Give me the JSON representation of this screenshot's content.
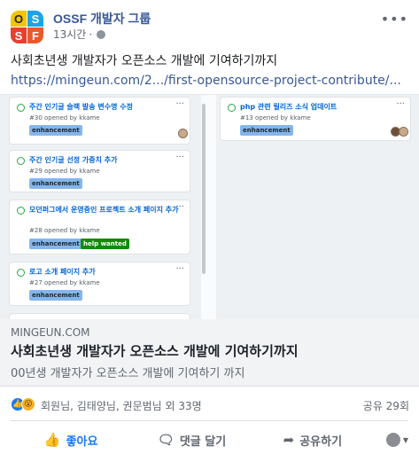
{
  "post": {
    "page_name": "OSSF 개발자 그룹",
    "time": "13시간",
    "meta_separator": "·",
    "text": "사회초년생 개발자가 오픈소스 개발에 기여하기까지",
    "link": "https://mingeun.com/2.../first-opensource-project-contribute/..."
  },
  "logo_letters": [
    "O",
    "S",
    "S",
    "F"
  ],
  "board": {
    "left_column": [
      {
        "title": "주간 인기글 슬랙 발송 변수명 수정",
        "sub": "#30 opened by kkame",
        "labels": [
          "enhancement"
        ]
      },
      {
        "title": "주간 인기글 선정 가중치 추가",
        "sub": "#29 opened by kkame",
        "labels": [
          "enhancement"
        ]
      },
      {
        "title": "모던퍼그에서 운영중인 프로젝트 소개 페이지 추가",
        "sub": "#28 opened by kkame",
        "labels": [
          "enhancement",
          "help wanted"
        ]
      },
      {
        "title": "로고 소개 페이지 추가",
        "sub": "#27 opened by kkame",
        "labels": [
          "enhancement"
        ]
      }
    ],
    "right_column": [
      {
        "title": "php 관련 릴리즈 소식 업데이트",
        "sub": "#13 opened by kkame",
        "labels": [
          "enhancement"
        ]
      }
    ]
  },
  "link_preview": {
    "domain": "MINGEUN.COM",
    "title": "사회초년생 개발자가 오픈소스 개발에 기여하기까지",
    "description": "00년생 개발자가 오픈소스 개발에 기여하기 까지"
  },
  "reactions": {
    "names": "회원님, 김태양님, 권문범님 외 33명",
    "shares": "공유 29회"
  },
  "actions": {
    "like": "좋아요",
    "comment": "댓글 달기",
    "share": "공유하기"
  },
  "colors": {
    "link": "#385898",
    "like_blue": "#1877f2",
    "label_enhancement": "#84b6eb",
    "label_help": "#128a0c"
  }
}
